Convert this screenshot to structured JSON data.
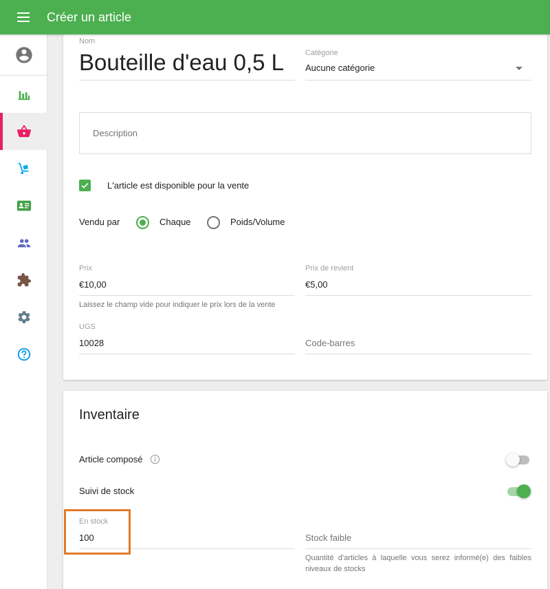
{
  "header": {
    "title": "Créer un article"
  },
  "sidebar": {
    "items": [
      {
        "icon": "bar-chart-icon",
        "color": "#4caf50"
      },
      {
        "icon": "basket-icon",
        "color": "#e91e63",
        "active": true
      },
      {
        "icon": "hand-truck-icon",
        "color": "#03a9f4"
      },
      {
        "icon": "id-card-icon",
        "color": "#43a047"
      },
      {
        "icon": "people-icon",
        "color": "#5c6bc0"
      },
      {
        "icon": "puzzle-icon",
        "color": "#795548"
      },
      {
        "icon": "gear-icon",
        "color": "#607d8b"
      },
      {
        "icon": "help-icon",
        "color": "#039be5"
      }
    ]
  },
  "item": {
    "name_label": "Nom",
    "name_value": "Bouteille d'eau 0,5 L",
    "category_label": "Catégorie",
    "category_value": "Aucune catégorie",
    "description_placeholder": "Description",
    "available_label": "L'article est disponible pour la vente",
    "sold_by_label": "Vendu par",
    "sold_by_options": [
      "Chaque",
      "Poids/Volume"
    ],
    "sold_by_selected": "Chaque",
    "price_label": "Prix",
    "price_value": "€10,00",
    "price_helper": "Laissez le champ vide pour indiquer le prix lors de la vente",
    "cost_label": "Prix de revient",
    "cost_value": "€5,00",
    "sku_label": "UGS",
    "sku_value": "10028",
    "barcode_placeholder": "Code-barres"
  },
  "inventory": {
    "title": "Inventaire",
    "composite_label": "Article composé",
    "composite_on": false,
    "track_stock_label": "Suivi de stock",
    "track_stock_on": true,
    "in_stock_label": "En stock",
    "in_stock_value": "100",
    "low_stock_placeholder": "Stock faible",
    "low_stock_helper": "Quantité d'articles à laquelle vous serez informé(e) des faibles niveaux de stocks"
  },
  "colors": {
    "primary": "#4caf50",
    "accent": "#e91e63",
    "highlight": "#e07b2c"
  }
}
